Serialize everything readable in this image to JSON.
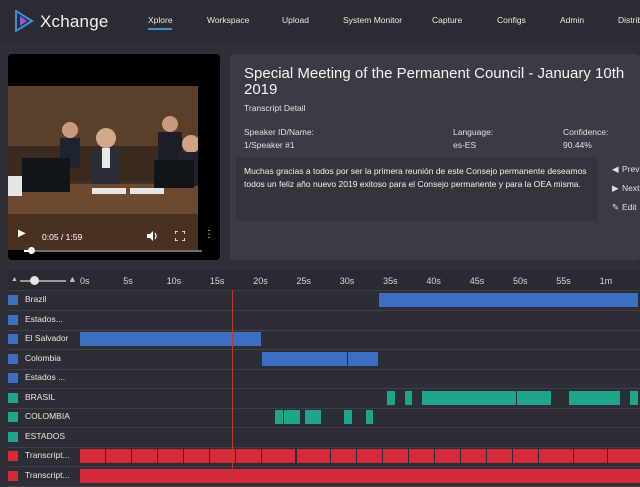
{
  "app": {
    "name": "Xchange"
  },
  "nav": {
    "items": [
      "Xplore",
      "Workspace",
      "Upload",
      "System Monitor",
      "Capture",
      "Configs",
      "Admin",
      "Distrib"
    ],
    "active": "Xplore"
  },
  "video": {
    "time": "0:05 / 1:59",
    "progress_fraction": 0.042
  },
  "details": {
    "title": "Special Meeting of the Permanent Council - January 10th 2019",
    "subtitle": "Transcript Detail",
    "speaker_label": "Speaker ID/Name:",
    "speaker_value": "1/Speaker #1",
    "language_label": "Language:",
    "language_value": "es-ES",
    "confidence_label": "Confidence:",
    "confidence_value": "90.44%",
    "transcript": "Muchas gracias a todos por ser la primera reunión de este Consejo permanente deseamos todos un feliz año nuevo 2019 exitoso para el Consejo permanente y para la OEA misma.",
    "actions": [
      "Prev",
      "Next",
      "Edit"
    ]
  },
  "timeline": {
    "ticks": [
      "0s",
      "5s",
      "10s",
      "15s",
      "20s",
      "25s",
      "30s",
      "35s",
      "40s",
      "45s",
      "50s",
      "55s",
      "1m"
    ],
    "playhead_seconds": 17.5,
    "rows": [
      {
        "label": "Brazil",
        "color": "#3d6fc0",
        "segments": [
          [
            34.5,
            64.5
          ]
        ]
      },
      {
        "label": "Estados...",
        "color": "#3d6fc0",
        "segments": []
      },
      {
        "label": "El Salvador",
        "color": "#3d6fc0",
        "segments": [
          [
            0,
            21
          ]
        ]
      },
      {
        "label": "Colombia",
        "color": "#3d6fc0",
        "segments": [
          [
            21,
            31
          ],
          [
            31,
            34.5
          ]
        ]
      },
      {
        "label": "Estados ...",
        "color": "#3d6fc0",
        "segments": []
      },
      {
        "label": "BRASIL",
        "color": "#1fa58a",
        "segments": [
          [
            35.5,
            36.5
          ],
          [
            37.5,
            38.5
          ],
          [
            39.5,
            50.5
          ],
          [
            50.5,
            54.5
          ],
          [
            56.5,
            62.5
          ],
          [
            63.5,
            64.5
          ]
        ]
      },
      {
        "label": "COLOMBIA",
        "color": "#1fa58a",
        "segments": [
          [
            22.5,
            23.5
          ],
          [
            23.5,
            25.5
          ],
          [
            26,
            28
          ],
          [
            30.5,
            31.5
          ],
          [
            33,
            34
          ]
        ]
      },
      {
        "label": "ESTADOS",
        "color": "#1fa58a",
        "segments": []
      },
      {
        "label": "Transcript...",
        "color": "#d32b3a",
        "segments": [
          [
            0,
            3
          ],
          [
            3,
            6
          ],
          [
            6,
            9
          ],
          [
            9,
            12
          ],
          [
            12,
            15
          ],
          [
            15,
            18
          ],
          [
            18,
            21
          ],
          [
            21,
            25
          ],
          [
            25,
            29
          ],
          [
            29,
            32
          ],
          [
            32,
            35
          ],
          [
            35,
            38
          ],
          [
            38,
            41
          ],
          [
            41,
            44
          ],
          [
            44,
            47
          ],
          [
            47,
            50
          ],
          [
            50,
            53
          ],
          [
            53,
            57
          ],
          [
            57,
            61
          ],
          [
            61,
            65
          ]
        ]
      },
      {
        "label": "Transcript...",
        "color": "#d32b3a",
        "segments": [
          [
            0,
            65
          ]
        ]
      }
    ]
  }
}
